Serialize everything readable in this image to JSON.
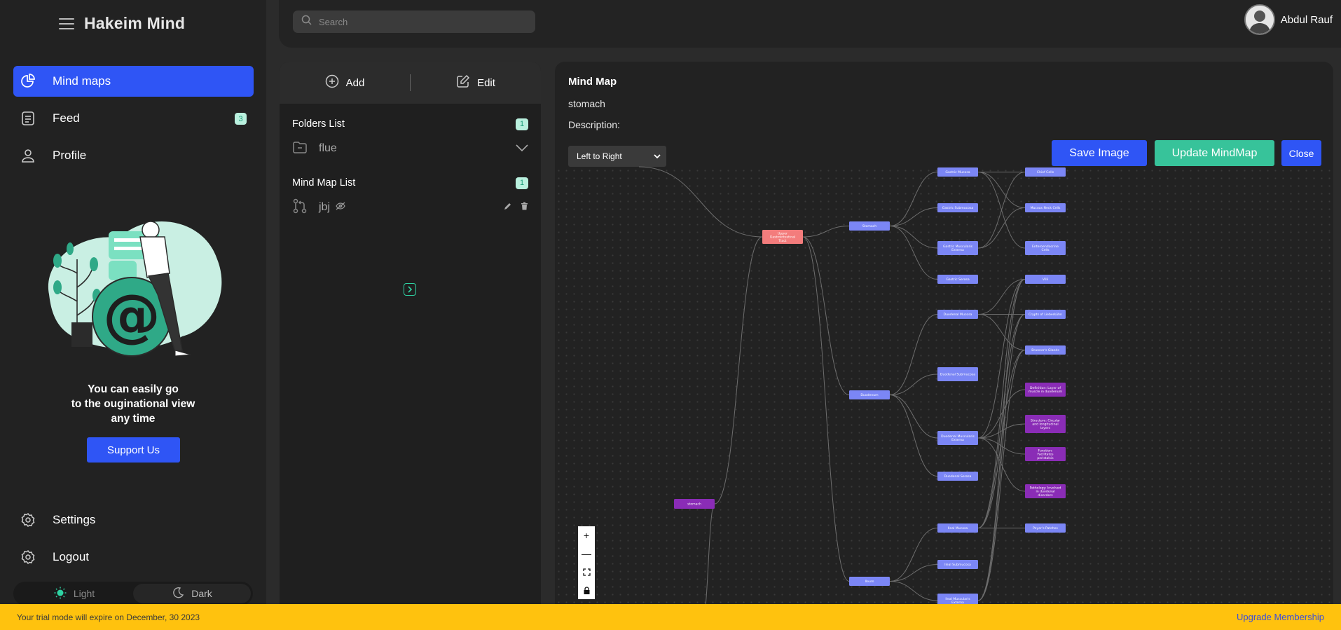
{
  "brand": {
    "title": "Hakeim Mind"
  },
  "sidebar": {
    "items": [
      {
        "label": "Mind maps",
        "icon": "pie-chart-icon",
        "active": true
      },
      {
        "label": "Feed",
        "icon": "document-icon",
        "badge": "3"
      },
      {
        "label": "Profile",
        "icon": "user-icon"
      }
    ],
    "promo": {
      "line1": "You can easily go",
      "line2": "to the ouginational view",
      "line3": "any time",
      "button": "Support Us"
    },
    "bottom": [
      {
        "label": "Settings",
        "icon": "gear-icon"
      },
      {
        "label": "Logout",
        "icon": "gear-icon"
      }
    ],
    "theme": {
      "light": "Light",
      "dark": "Dark",
      "selected": "dark"
    }
  },
  "topbar": {
    "search_placeholder": "Search",
    "user_name": "Abdul Rauf"
  },
  "panel": {
    "add_label": "Add",
    "edit_label": "Edit",
    "folders_title": "Folders List",
    "folders_count": "1",
    "folders": [
      {
        "name": "flue"
      }
    ],
    "maps_title": "Mind Map List",
    "maps_count": "1",
    "maps": [
      {
        "name": "jbj"
      }
    ]
  },
  "mindmap": {
    "title": "Mind Map",
    "name": "stomach",
    "description_label": "Description:",
    "direction": "Left to Right",
    "save_label": "Save Image",
    "update_label": "Update MindMap",
    "close_label": "Close",
    "colors": {
      "node": "#7b86f5",
      "root": "#8a2cb6",
      "upper": "#f37c7c",
      "detail": "#8a2cb6"
    },
    "nodes": {
      "root": "stomach",
      "upper": "Upper Gastrointestinal Tract",
      "l1": [
        "Stomach",
        "Duodenum",
        "Ileum"
      ],
      "stomach_children": [
        "Gastric Mucosa",
        "Gastric Submucosa",
        "Gastric Muscularis Externa",
        "Gastric Serosa"
      ],
      "stomach_cells": [
        "Chief Cells",
        "Mucous Neck Cells",
        "Enteroendocrine Cells"
      ],
      "duodenum_children": [
        "Duodenal Mucosa",
        "Duodenal Submucosa",
        "Duodenal Muscularis Externa",
        "Duodenal Serosa"
      ],
      "duodenum_details": [
        "Villi",
        "Crypts of Lieberkühn",
        "Brunner's Glands"
      ],
      "purple_details": [
        "Definition: Layer of muscle in duodenum",
        "Structure: Circular and longitudinal layers",
        "Function: Facilitates peristalsis",
        "Pathology: Involved in duodenal disorders"
      ],
      "ileum_children": [
        "Ileal Mucosa",
        "Ileal Submucosa",
        "Ileal Muscularis Externa"
      ],
      "ileum_details": [
        "Peyer's Patches"
      ]
    }
  },
  "trial": {
    "message": "Your trial mode will expire on December, 30 2023",
    "link": "Upgrade Membership"
  }
}
